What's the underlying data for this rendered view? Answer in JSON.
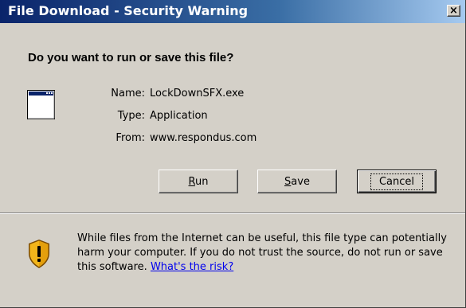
{
  "window": {
    "title": "File Download - Security Warning",
    "close_label": "×"
  },
  "heading": "Do you want to run or save this file?",
  "file": {
    "name_label": "Name:",
    "name_value": "LockDownSFX.exe",
    "type_label": "Type:",
    "type_value": "Application",
    "from_label": "From:",
    "from_value": "www.respondus.com"
  },
  "buttons": {
    "run": {
      "accel": "R",
      "rest": "un"
    },
    "save": {
      "accel": "S",
      "rest": "ave"
    },
    "cancel": "Cancel"
  },
  "warning": {
    "text": "While files from the Internet can be useful, this file type can potentially harm your computer. If you do not trust the source, do not run or save this software. ",
    "link": "What's the risk?"
  },
  "icons": {
    "app": "application-window-icon",
    "warning": "security-shield-icon"
  },
  "colors": {
    "titlebar_start": "#0a246a",
    "titlebar_end": "#a6caf0",
    "dialog_bg": "#d4d0c8",
    "link": "#0000ee"
  }
}
